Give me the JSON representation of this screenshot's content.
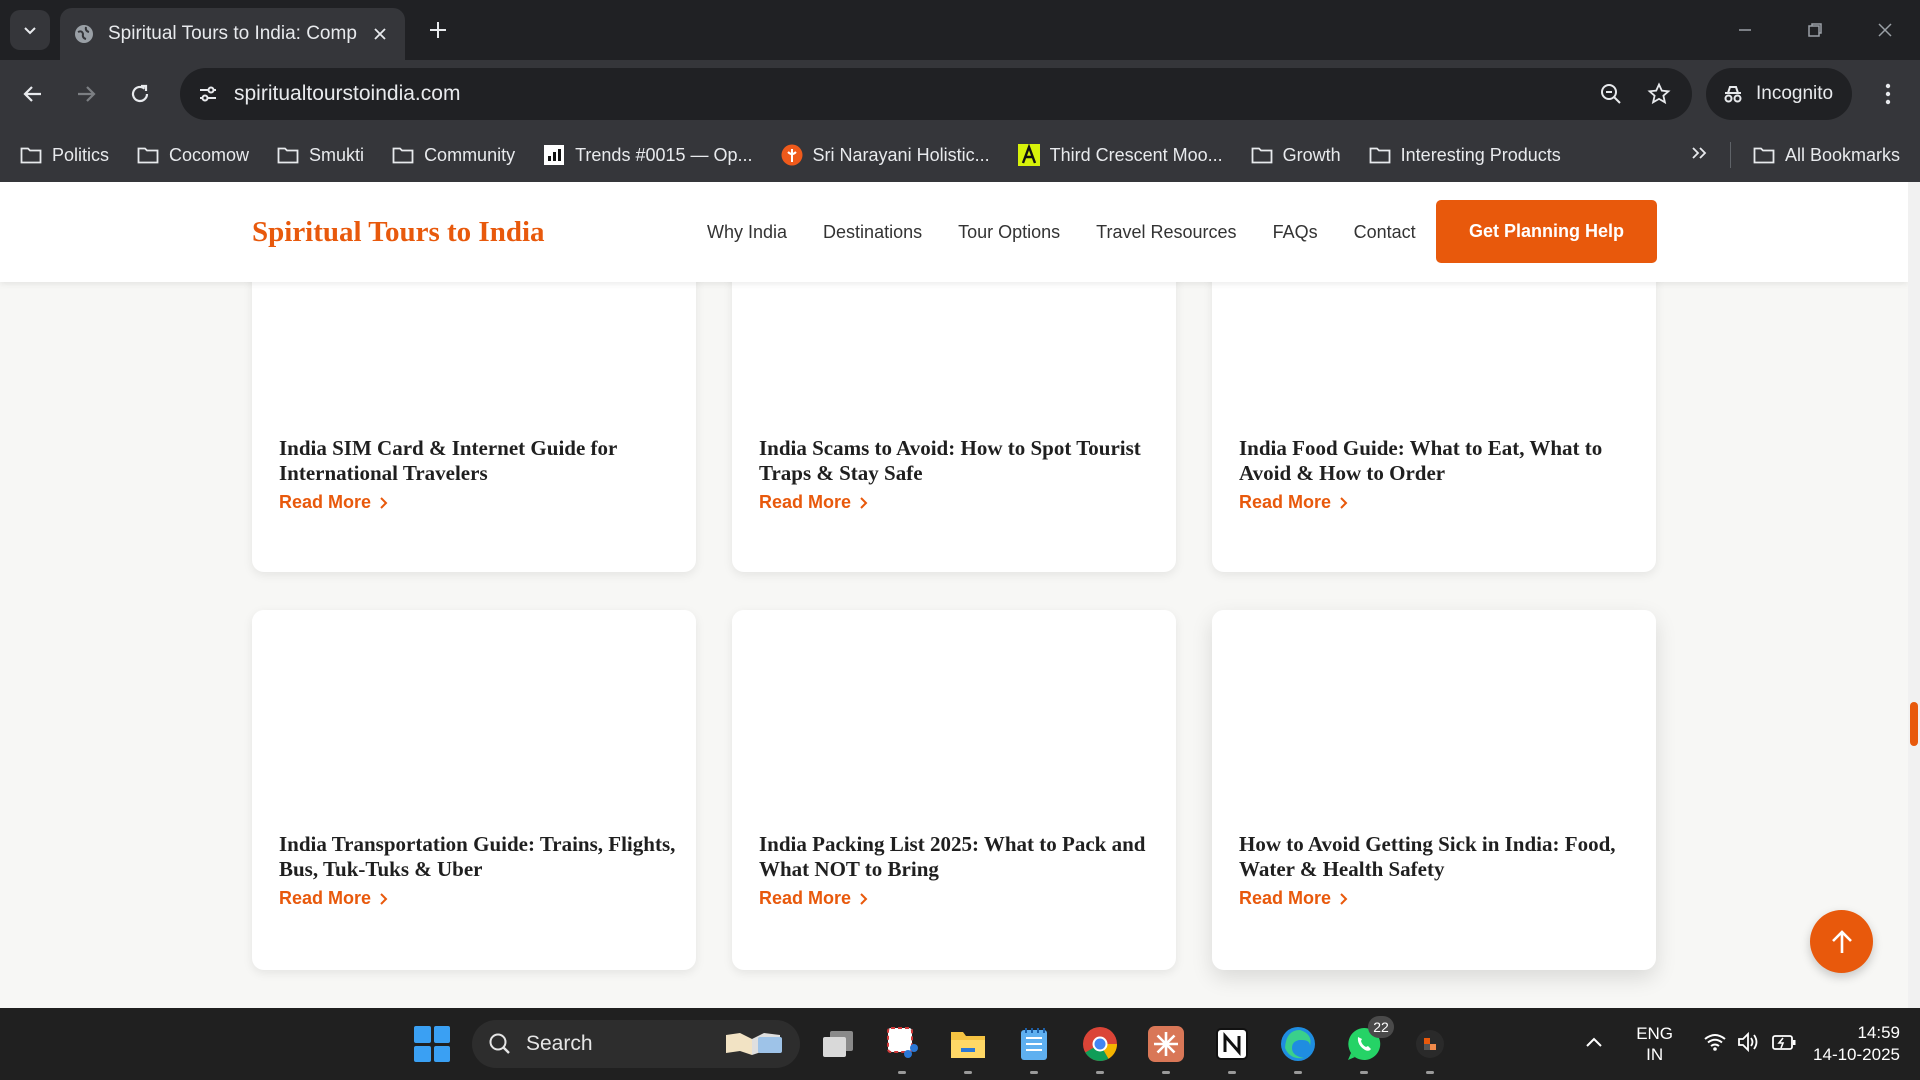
{
  "browser": {
    "tab_title": "Spiritual Tours to India: Comple",
    "url": "spiritualtourstoindia.com",
    "incognito_label": "Incognito",
    "bookmarks": [
      {
        "label": "Politics",
        "icon": "folder-icon"
      },
      {
        "label": "Cocomow",
        "icon": "folder-icon"
      },
      {
        "label": "Smukti",
        "icon": "folder-icon"
      },
      {
        "label": "Community",
        "icon": "folder-icon"
      },
      {
        "label": "Trends #0015 — Op...",
        "icon": "trends-favicon"
      },
      {
        "label": "Sri Narayani Holistic...",
        "icon": "narayani-favicon"
      },
      {
        "label": "Third Crescent Moo...",
        "icon": "crescent-favicon"
      },
      {
        "label": "Growth",
        "icon": "folder-icon"
      },
      {
        "label": "Interesting Products",
        "icon": "folder-icon"
      }
    ],
    "all_bookmarks_label": "All Bookmarks"
  },
  "site": {
    "logo": "Spiritual Tours to India",
    "nav": [
      "Why India",
      "Destinations",
      "Tour Options",
      "Travel Resources",
      "FAQs",
      "Contact"
    ],
    "cta": "Get Planning Help",
    "accent": "#e8590c",
    "read_more": "Read More",
    "cards": [
      {
        "title": "India SIM Card & Internet Guide for International Travelers"
      },
      {
        "title": "India Scams to Avoid: How to Spot Tourist Traps & Stay Safe"
      },
      {
        "title": "India Food Guide: What to Eat, What to Avoid & How to Order"
      },
      {
        "title": "India Transportation Guide: Trains, Flights, Bus, Tuk-Tuks & Uber"
      },
      {
        "title": "India Packing List 2025: What to Pack and What NOT to Bring"
      },
      {
        "title": "How to Avoid Getting Sick in India: Food, Water & Health Safety"
      }
    ]
  },
  "taskbar": {
    "search_placeholder": "Search",
    "whatsapp_badge": "22",
    "lang_line1": "ENG",
    "lang_line2": "IN",
    "time": "14:59",
    "date": "14-10-2025"
  }
}
